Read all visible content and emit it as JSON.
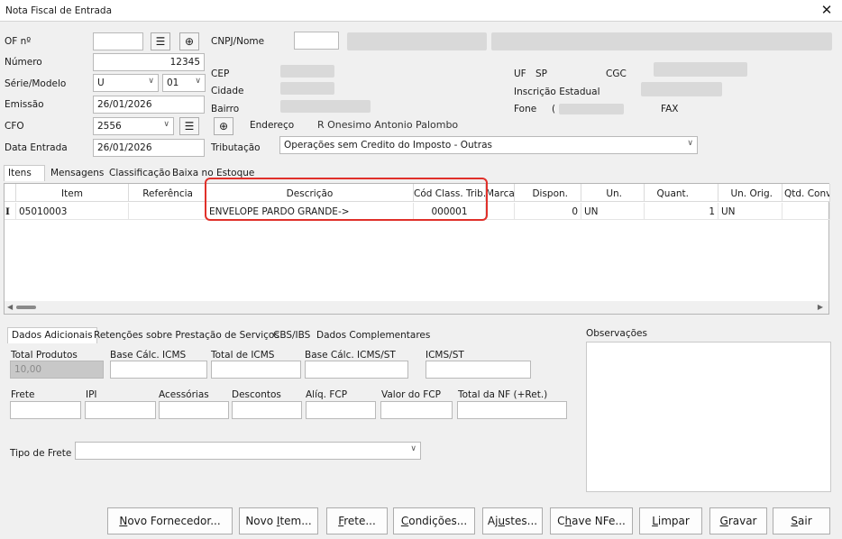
{
  "window": {
    "title": "Nota Fiscal de Entrada"
  },
  "header": {
    "of_label": "OF nº",
    "cnpj_label": "CNPJ/Nome",
    "numero_label": "Número",
    "numero_value": "12345",
    "serie_label": "Série/Modelo",
    "serie_value": "U",
    "modelo_value": "01",
    "emissao_label": "Emissão",
    "emissao_value": "26/01/2026",
    "cfo_label": "CFO",
    "cfo_value": "2556",
    "data_entrada_label": "Data Entrada",
    "data_entrada_value": "26/01/2026",
    "cep_label": "CEP",
    "cidade_label": "Cidade",
    "bairro_label": "Bairro",
    "endereco_label": "Endereço",
    "endereco_value": "R Onesimo Antonio Palombo",
    "tributacao_label": "Tributação",
    "tributacao_value": "Operações sem Credito do Imposto - Outras",
    "uf_label": "UF",
    "uf_value": "SP",
    "cgc_label": "CGC",
    "ie_label": "Inscrição Estadual",
    "fone_label": "Fone",
    "fone_value": "(",
    "fax_label": "FAX"
  },
  "tabs": [
    "Itens",
    "Mensagens",
    "Classificação",
    "Baixa no Estoque"
  ],
  "grid": {
    "columns": [
      "Item",
      "Referência",
      "Descrição",
      "Cód Class. Trib.",
      "Marca",
      "Dispon.",
      "Un.",
      "Quant.",
      "Un. Orig.",
      "Qtd. Conv"
    ],
    "rows": [
      {
        "marker": "I",
        "item": "05010003",
        "referencia": "",
        "descricao": "ENVELOPE PARDO GRANDE->",
        "cod_class": "000001",
        "marca": "",
        "dispon": "0",
        "un": "UN",
        "quant": "1",
        "un_orig": "UN",
        "qtd_conv": ""
      }
    ]
  },
  "bottom_tabs": [
    "Dados Adicionais",
    "Retenções sobre Prestação de Serviços",
    "CBS/IBS",
    "Dados Complementares"
  ],
  "totals": {
    "total_produtos_label": "Total Produtos",
    "total_produtos_value": "10,00",
    "base_icms_label": "Base Cálc. ICMS",
    "total_icms_label": "Total de ICMS",
    "base_icms_st_label": "Base Cálc. ICMS/ST",
    "icms_st_label": "ICMS/ST",
    "frete_label": "Frete",
    "ipi_label": "IPI",
    "acessorias_label": "Acessórias",
    "descontos_label": "Descontos",
    "aliq_fcp_label": "Alíq. FCP",
    "valor_fcp_label": "Valor do FCP",
    "total_nf_label": "Total da NF (+Ret.)",
    "tipo_frete_label": "Tipo de Frete"
  },
  "observacoes_label": "Observações",
  "buttons": [
    {
      "u": "N",
      "rest": "ovo Fornecedor..."
    },
    {
      "pre": "Novo ",
      "u": "I",
      "rest": "tem..."
    },
    {
      "u": "F",
      "rest": "rete..."
    },
    {
      "u": "C",
      "rest": "ondições..."
    },
    {
      "pre": "Aj",
      "u": "u",
      "rest": "stes..."
    },
    {
      "pre": "C",
      "u": "h",
      "rest": "ave NFe..."
    },
    {
      "u": "L",
      "rest": "impar"
    },
    {
      "u": "G",
      "rest": "ravar"
    },
    {
      "u": "S",
      "rest": "air"
    }
  ]
}
